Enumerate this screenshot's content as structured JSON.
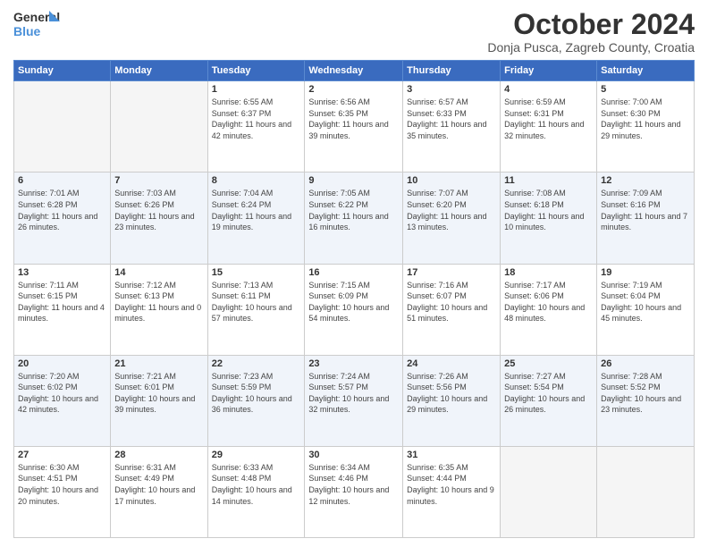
{
  "header": {
    "logo_line1": "General",
    "logo_line2": "Blue",
    "title": "October 2024",
    "subtitle": "Donja Pusca, Zagreb County, Croatia"
  },
  "columns": [
    "Sunday",
    "Monday",
    "Tuesday",
    "Wednesday",
    "Thursday",
    "Friday",
    "Saturday"
  ],
  "weeks": [
    [
      {
        "day": "",
        "info": ""
      },
      {
        "day": "",
        "info": ""
      },
      {
        "day": "1",
        "info": "Sunrise: 6:55 AM\nSunset: 6:37 PM\nDaylight: 11 hours and 42 minutes."
      },
      {
        "day": "2",
        "info": "Sunrise: 6:56 AM\nSunset: 6:35 PM\nDaylight: 11 hours and 39 minutes."
      },
      {
        "day": "3",
        "info": "Sunrise: 6:57 AM\nSunset: 6:33 PM\nDaylight: 11 hours and 35 minutes."
      },
      {
        "day": "4",
        "info": "Sunrise: 6:59 AM\nSunset: 6:31 PM\nDaylight: 11 hours and 32 minutes."
      },
      {
        "day": "5",
        "info": "Sunrise: 7:00 AM\nSunset: 6:30 PM\nDaylight: 11 hours and 29 minutes."
      }
    ],
    [
      {
        "day": "6",
        "info": "Sunrise: 7:01 AM\nSunset: 6:28 PM\nDaylight: 11 hours and 26 minutes."
      },
      {
        "day": "7",
        "info": "Sunrise: 7:03 AM\nSunset: 6:26 PM\nDaylight: 11 hours and 23 minutes."
      },
      {
        "day": "8",
        "info": "Sunrise: 7:04 AM\nSunset: 6:24 PM\nDaylight: 11 hours and 19 minutes."
      },
      {
        "day": "9",
        "info": "Sunrise: 7:05 AM\nSunset: 6:22 PM\nDaylight: 11 hours and 16 minutes."
      },
      {
        "day": "10",
        "info": "Sunrise: 7:07 AM\nSunset: 6:20 PM\nDaylight: 11 hours and 13 minutes."
      },
      {
        "day": "11",
        "info": "Sunrise: 7:08 AM\nSunset: 6:18 PM\nDaylight: 11 hours and 10 minutes."
      },
      {
        "day": "12",
        "info": "Sunrise: 7:09 AM\nSunset: 6:16 PM\nDaylight: 11 hours and 7 minutes."
      }
    ],
    [
      {
        "day": "13",
        "info": "Sunrise: 7:11 AM\nSunset: 6:15 PM\nDaylight: 11 hours and 4 minutes."
      },
      {
        "day": "14",
        "info": "Sunrise: 7:12 AM\nSunset: 6:13 PM\nDaylight: 11 hours and 0 minutes."
      },
      {
        "day": "15",
        "info": "Sunrise: 7:13 AM\nSunset: 6:11 PM\nDaylight: 10 hours and 57 minutes."
      },
      {
        "day": "16",
        "info": "Sunrise: 7:15 AM\nSunset: 6:09 PM\nDaylight: 10 hours and 54 minutes."
      },
      {
        "day": "17",
        "info": "Sunrise: 7:16 AM\nSunset: 6:07 PM\nDaylight: 10 hours and 51 minutes."
      },
      {
        "day": "18",
        "info": "Sunrise: 7:17 AM\nSunset: 6:06 PM\nDaylight: 10 hours and 48 minutes."
      },
      {
        "day": "19",
        "info": "Sunrise: 7:19 AM\nSunset: 6:04 PM\nDaylight: 10 hours and 45 minutes."
      }
    ],
    [
      {
        "day": "20",
        "info": "Sunrise: 7:20 AM\nSunset: 6:02 PM\nDaylight: 10 hours and 42 minutes."
      },
      {
        "day": "21",
        "info": "Sunrise: 7:21 AM\nSunset: 6:01 PM\nDaylight: 10 hours and 39 minutes."
      },
      {
        "day": "22",
        "info": "Sunrise: 7:23 AM\nSunset: 5:59 PM\nDaylight: 10 hours and 36 minutes."
      },
      {
        "day": "23",
        "info": "Sunrise: 7:24 AM\nSunset: 5:57 PM\nDaylight: 10 hours and 32 minutes."
      },
      {
        "day": "24",
        "info": "Sunrise: 7:26 AM\nSunset: 5:56 PM\nDaylight: 10 hours and 29 minutes."
      },
      {
        "day": "25",
        "info": "Sunrise: 7:27 AM\nSunset: 5:54 PM\nDaylight: 10 hours and 26 minutes."
      },
      {
        "day": "26",
        "info": "Sunrise: 7:28 AM\nSunset: 5:52 PM\nDaylight: 10 hours and 23 minutes."
      }
    ],
    [
      {
        "day": "27",
        "info": "Sunrise: 6:30 AM\nSunset: 4:51 PM\nDaylight: 10 hours and 20 minutes."
      },
      {
        "day": "28",
        "info": "Sunrise: 6:31 AM\nSunset: 4:49 PM\nDaylight: 10 hours and 17 minutes."
      },
      {
        "day": "29",
        "info": "Sunrise: 6:33 AM\nSunset: 4:48 PM\nDaylight: 10 hours and 14 minutes."
      },
      {
        "day": "30",
        "info": "Sunrise: 6:34 AM\nSunset: 4:46 PM\nDaylight: 10 hours and 12 minutes."
      },
      {
        "day": "31",
        "info": "Sunrise: 6:35 AM\nSunset: 4:44 PM\nDaylight: 10 hours and 9 minutes."
      },
      {
        "day": "",
        "info": ""
      },
      {
        "day": "",
        "info": ""
      }
    ]
  ]
}
